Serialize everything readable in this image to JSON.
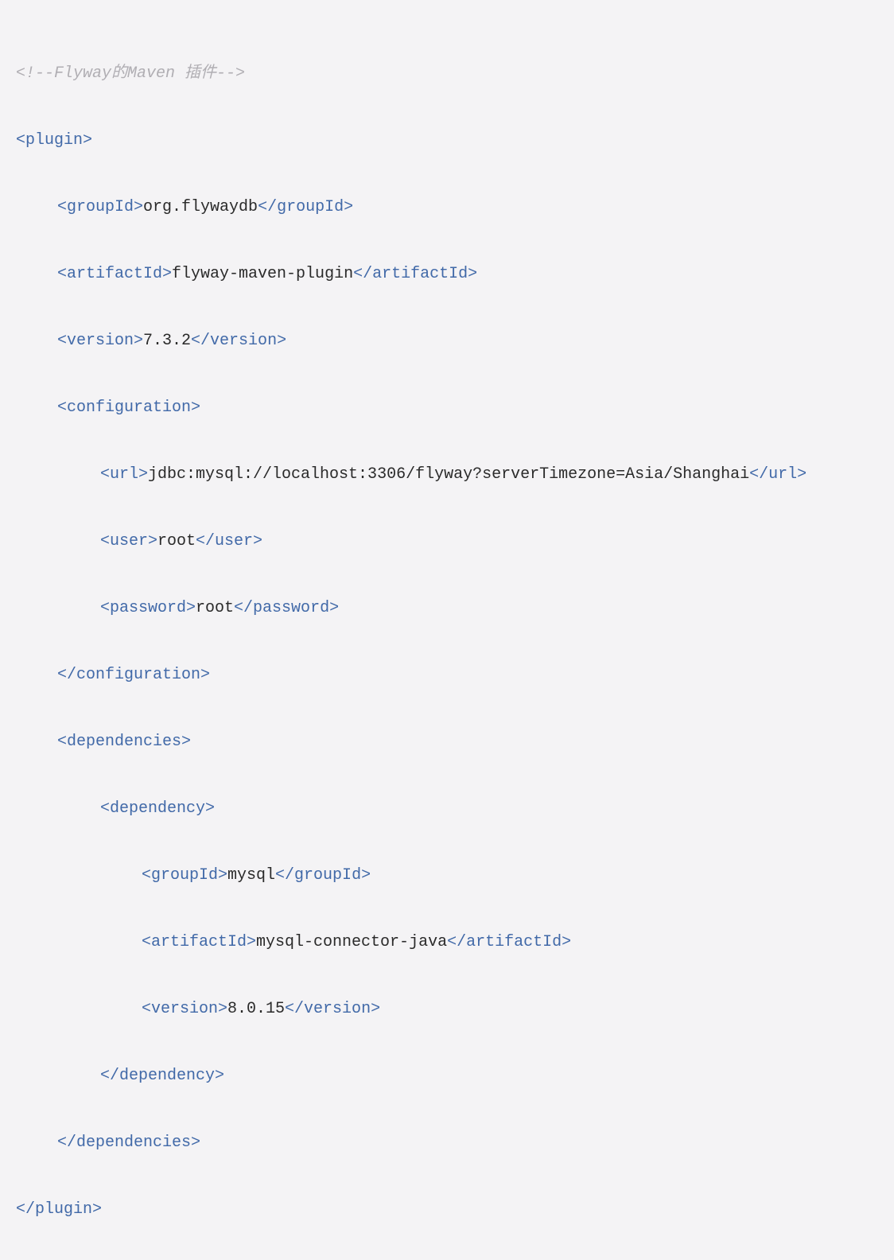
{
  "comment": "<!--Flyway的Maven 插件-->",
  "plugin_open": "<plugin>",
  "groupId_open": "<groupId>",
  "groupId_val": "org.flywaydb",
  "groupId_close": "</groupId>",
  "artifactId_open": "<artifactId>",
  "artifactId_val": "flyway-maven-plugin",
  "artifactId_close": "</artifactId>",
  "version_open": "<version>",
  "version_val": "7.3.2",
  "version_close": "</version>",
  "configuration_open": "<configuration>",
  "url_open": "<url>",
  "url_val": "jdbc:mysql://localhost:3306/flyway?serverTimezone=Asia/Shanghai",
  "url_close": "</url>",
  "user_open": "<user>",
  "user_val": "root",
  "user_close": "</user>",
  "password_open": "<password>",
  "password_val": "root",
  "password_close": "</password>",
  "configuration_close": "</configuration>",
  "dependencies_open": "<dependencies>",
  "dependency_open": "<dependency>",
  "dep_groupId_open": "<groupId>",
  "dep_groupId_val": "mysql",
  "dep_groupId_close": "</groupId>",
  "dep_artifactId_open": "<artifactId>",
  "dep_artifactId_val": "mysql-connector-java",
  "dep_artifactId_close": "</artifactId>",
  "dep_version_open": "<version>",
  "dep_version_val": "8.0.15",
  "dep_version_close": "</version>",
  "dependency_close": "</dependency>",
  "dependencies_close": "</dependencies>",
  "plugin_close": "</plugin>"
}
